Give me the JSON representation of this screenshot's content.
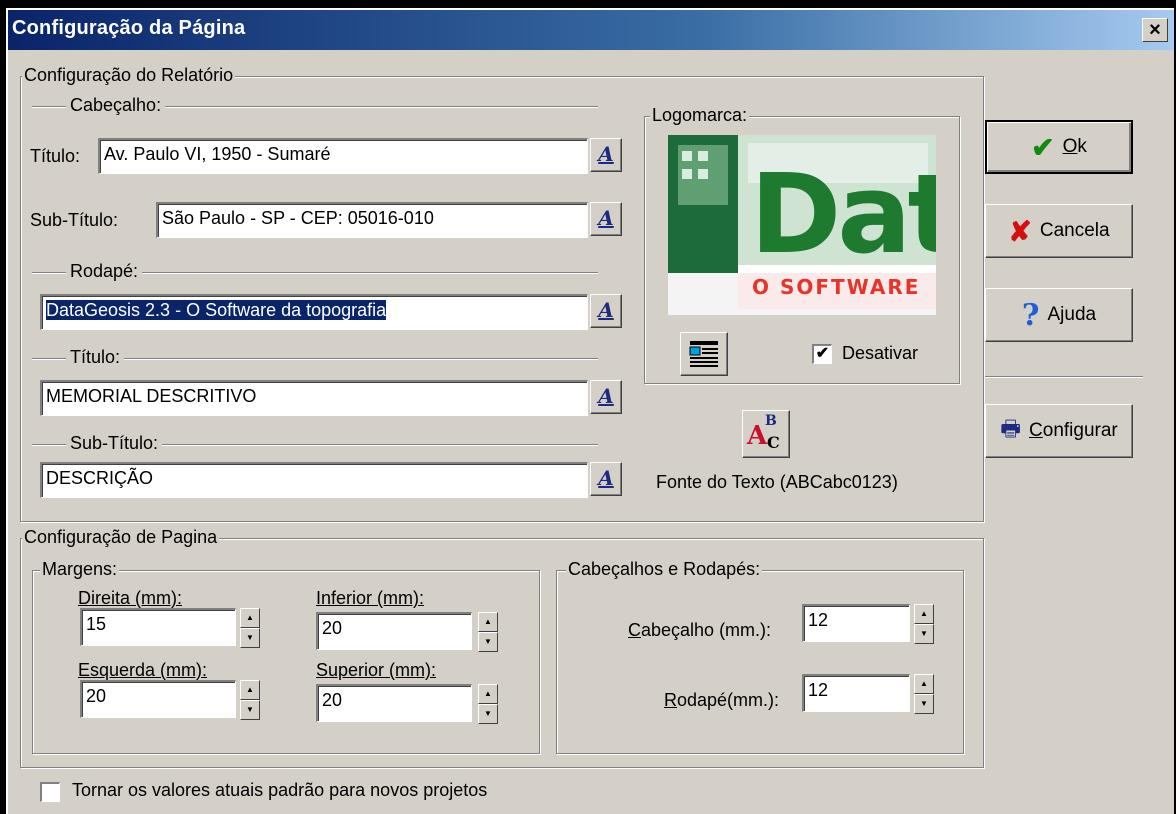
{
  "window": {
    "title": "Configuração da Página",
    "close": "×"
  },
  "relatorio": {
    "legend": "Configuração do Relatório",
    "cabecalho_label": "Cabeçalho:",
    "titulo_label": "Título:",
    "titulo_value": "Av. Paulo VI, 1950 - Sumaré",
    "subtitulo_label": "Sub-Título:",
    "subtitulo_value": "São Paulo - SP - CEP: 05016-010",
    "rodape_label": "Rodapé:",
    "rodape_value": "DataGeosis 2.3 - O Software da topografia",
    "titulo2_label": "Título:",
    "titulo2_value": "MEMORIAL DESCRITIVO",
    "subtitulo2_label": "Sub-Título:",
    "subtitulo2_value": "DESCRIÇÃO",
    "font_button_glyph": "A"
  },
  "logomarca": {
    "legend": "Logomarca:",
    "logo_text": "Dat",
    "logo_subtext": "O SOFTWARE",
    "desativar_label": "Desativar",
    "desativar_checked": "✔"
  },
  "fonte_texto": {
    "icon_text": "A",
    "label": "Fonte do Texto (ABCabc0123)"
  },
  "actions": {
    "ok": "Ok",
    "cancela": "Cancela",
    "ajuda": "Ajuda",
    "configurar": "Configurar"
  },
  "pagina": {
    "legend": "Configuração de Pagina",
    "margens_legend": "Margens:",
    "direita_label": "Direita (mm):",
    "direita_value": "15",
    "inferior_label": "Inferior (mm):",
    "inferior_value": "20",
    "esquerda_label": "Esquerda (mm):",
    "esquerda_value": "20",
    "superior_label": "Superior (mm):",
    "superior_value": "20",
    "cab_rod_legend": "Cabeçalhos e Rodapés:",
    "cabecalho_mm_label": "Cabeçalho (mm.):",
    "cabecalho_mm_value": "12",
    "rodape_mm_label": "Rodapé(mm.):",
    "rodape_mm_value": "12"
  },
  "default_checkbox_label": "Tornar os valores atuais padrão para novos projetos",
  "colors": {
    "accent": "#0a246a",
    "logo_green": "#1d7a2e",
    "logo_red": "#e8332a"
  }
}
